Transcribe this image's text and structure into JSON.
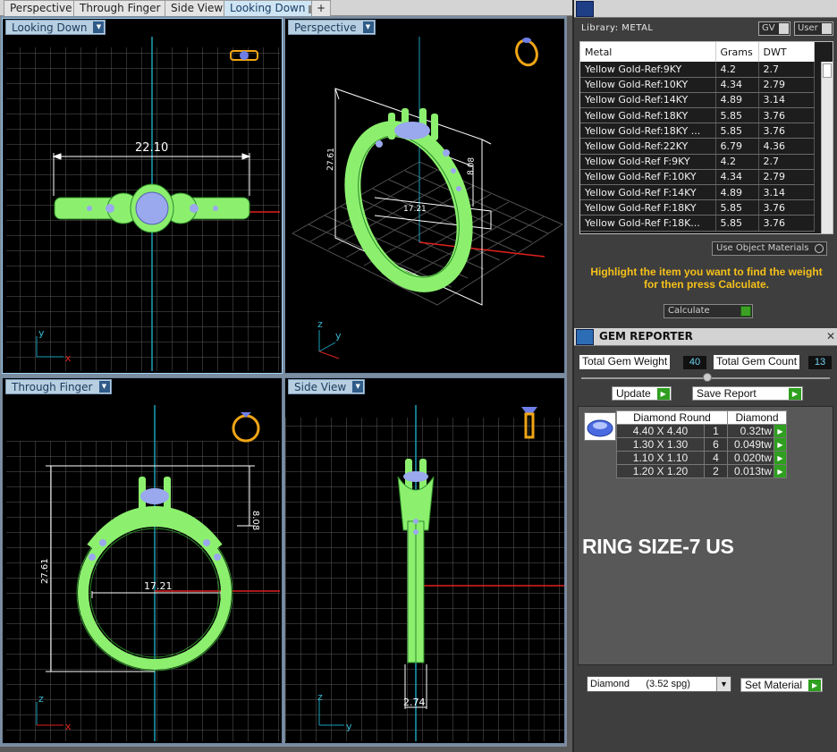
{
  "tabs": [
    {
      "label": "Perspective"
    },
    {
      "label": "Through Finger"
    },
    {
      "label": "Side View"
    },
    {
      "label": "Looking Down"
    },
    {
      "label": "+"
    }
  ],
  "viewports": {
    "looking_down": {
      "label": "Looking Down",
      "dimension": "22.10",
      "axis_v": "y",
      "axis_h": "x"
    },
    "perspective": {
      "label": "Perspective",
      "dims": [
        "27.61",
        "8.08",
        "17.21"
      ],
      "axis_v": "z",
      "axis_h": "y"
    },
    "through_finger": {
      "label": "Through Finger",
      "dim_height": "27.61",
      "dim_top": "8.08",
      "dim_inner": "17.21",
      "axis_v": "z",
      "axis_h": "x"
    },
    "side_view": {
      "label": "Side View",
      "dimension": "2.74",
      "axis_v": "z",
      "axis_h": "y"
    }
  },
  "library": {
    "title": "Library: METAL",
    "gv_label": "GV",
    "user_label": "User",
    "columns": [
      "Metal",
      "Grams",
      "DWT"
    ],
    "rows": [
      [
        "Yellow Gold-Ref:9KY",
        "4.2",
        "2.7"
      ],
      [
        "Yellow Gold-Ref:10KY",
        "4.34",
        "2.79"
      ],
      [
        "Yellow Gold-Ref:14KY",
        "4.89",
        "3.14"
      ],
      [
        "Yellow Gold-Ref:18KY",
        "5.85",
        "3.76"
      ],
      [
        "Yellow Gold-Ref:18KY ...",
        "5.85",
        "3.76"
      ],
      [
        "Yellow Gold-Ref:22KY",
        "6.79",
        "4.36"
      ],
      [
        "Yellow Gold-Ref F:9KY",
        "4.2",
        "2.7"
      ],
      [
        "Yellow Gold-Ref F:10KY",
        "4.34",
        "2.79"
      ],
      [
        "Yellow Gold-Ref F:14KY",
        "4.89",
        "3.14"
      ],
      [
        "Yellow Gold-Ref F:18KY",
        "5.85",
        "3.76"
      ],
      [
        "Yellow Gold-Ref F:18K...",
        "5.85",
        "3.76"
      ]
    ],
    "use_object_materials": "Use Object Materials",
    "hint": "Highlight the item you want to find the weight for then press Calculate.",
    "calculate": "Calculate"
  },
  "gem_reporter": {
    "title": "GEM REPORTER",
    "total_weight_label": "Total Gem Weight",
    "total_weight": "40",
    "total_count_label": "Total Gem Count",
    "total_count": "13",
    "update": "Update",
    "save_report": "Save Report",
    "columns": [
      "Diamond Round",
      "Diamond"
    ],
    "rows": [
      [
        "4.40 X 4.40",
        "1",
        "0.32tw"
      ],
      [
        "1.30 X 1.30",
        "6",
        "0.049tw"
      ],
      [
        "1.10 X 1.10",
        "4",
        "0.020tw"
      ],
      [
        "1.20 X 1.20",
        "2",
        "0.013tw"
      ]
    ],
    "ring_size": "RING SIZE-7 US",
    "material": "Diamond      (3.52 spg)",
    "set_material": "Set Material"
  },
  "colors": {
    "model_green": "#8cf06e",
    "gem_blue": "#9aa8ee",
    "axis_red": "#e0211d",
    "axis_cyan": "#1a9fb8",
    "hint_yellow": "#f6c11a"
  }
}
